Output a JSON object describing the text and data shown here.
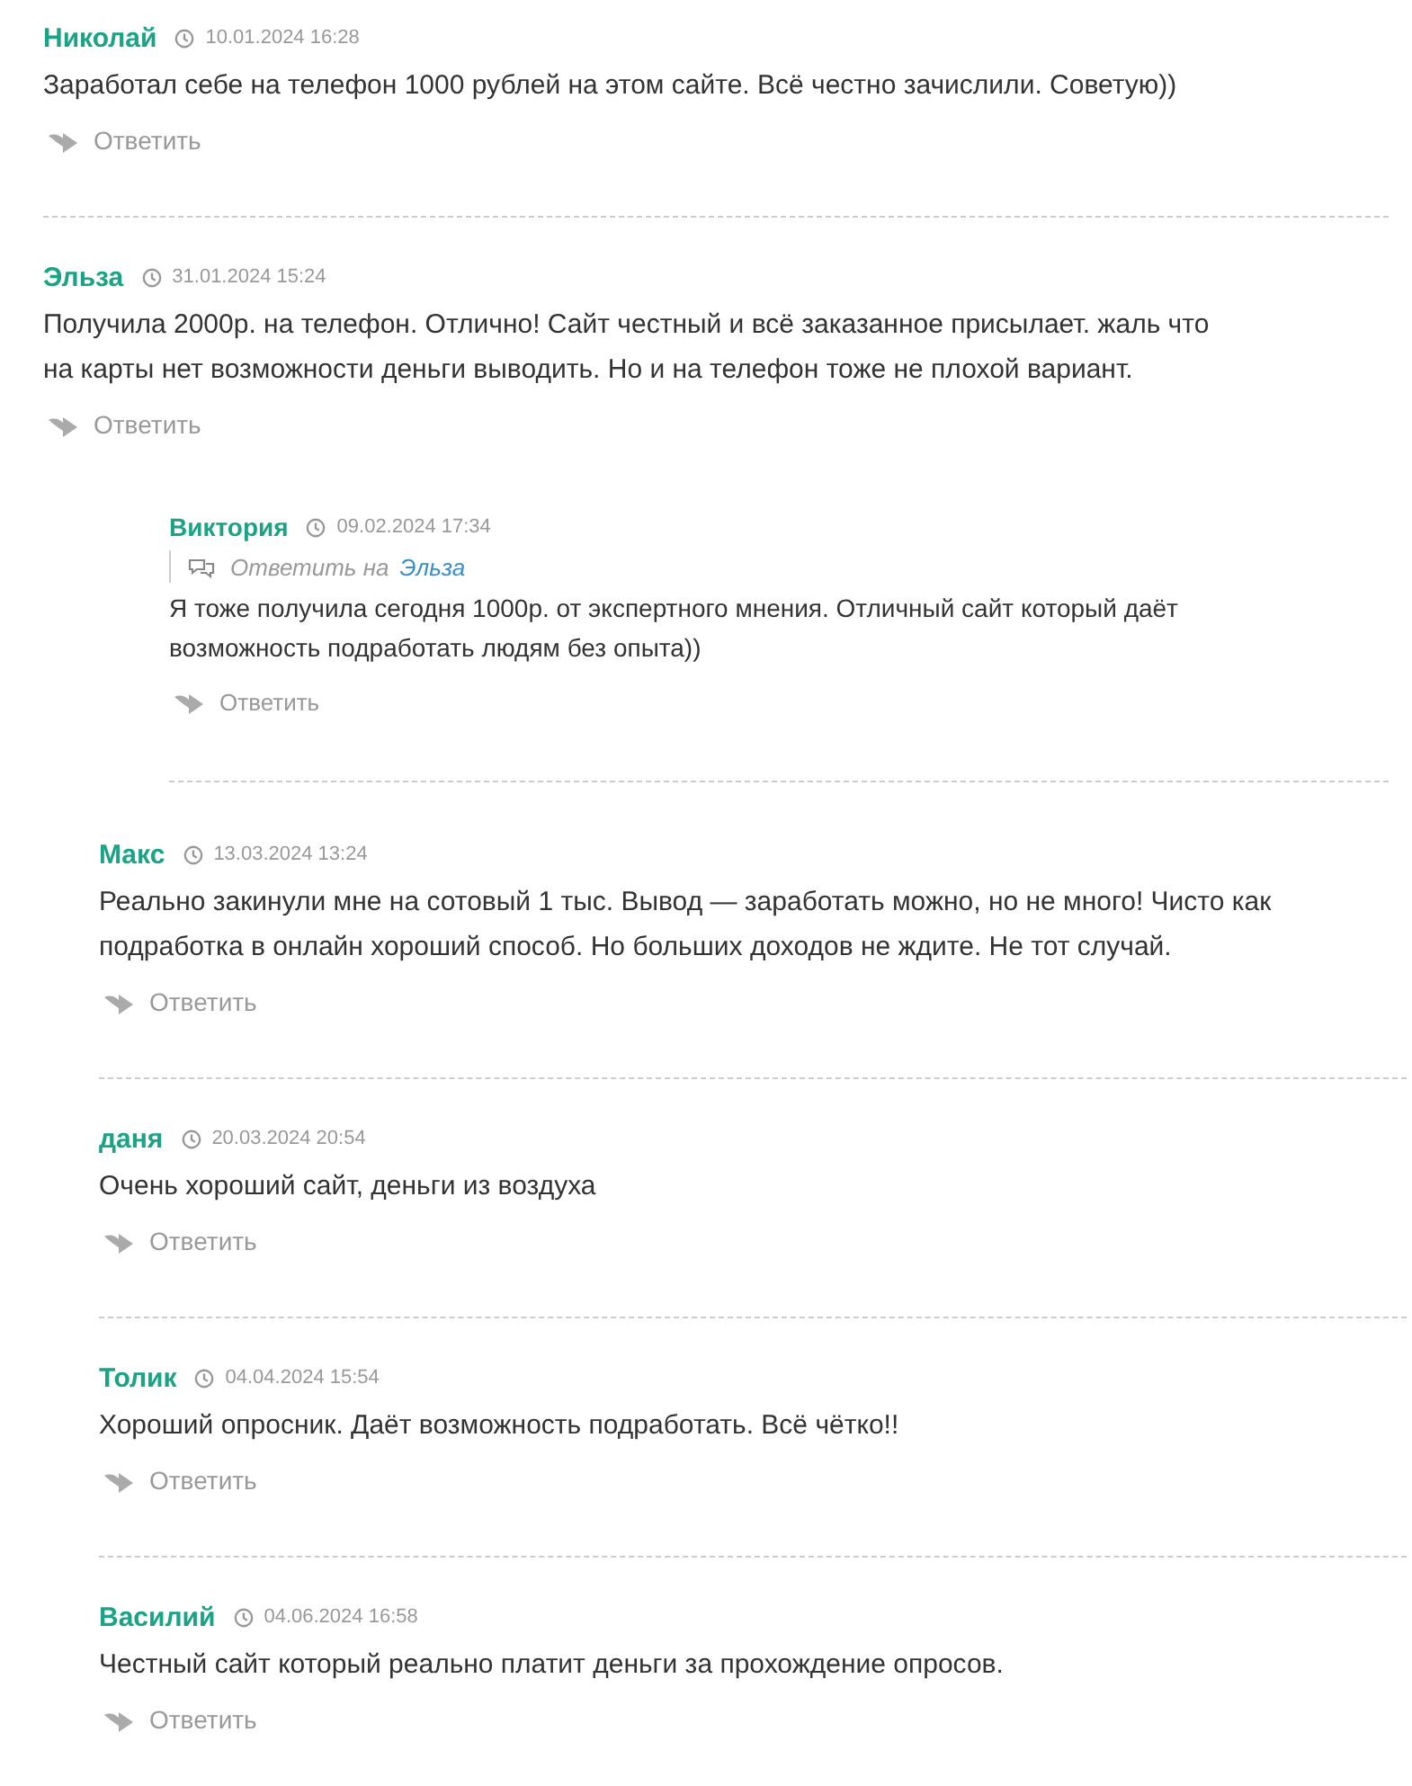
{
  "comments": [
    {
      "author": "Николай",
      "date": "10.01.2024 16:28",
      "text": "Заработал себе на телефон 1000 рублей на этом сайте. Всё честно зачислили. Советую))",
      "reply_label": "Ответить"
    },
    {
      "author": "Эльза",
      "date": "31.01.2024 15:24",
      "text": "Получила 2000р. на телефон. Отлично! Сайт честный и всё заказанное присылает. жаль что\nна карты нет возможности деньги выводить. Но и на телефон тоже не плохой вариант.",
      "reply_label": "Ответить",
      "children": [
        {
          "author": "Виктория",
          "date": "09.02.2024 17:34",
          "reply_to": {
            "label": "Ответить на",
            "name": "Эльза"
          },
          "text": "Я тоже получила сегодня 1000р. от экспертного мнения. Отличный сайт который даёт\nвозможность подработать людям без опыта))",
          "reply_label": "Ответить"
        }
      ]
    }
  ],
  "thread": [
    {
      "author": "Макс",
      "date": "13.03.2024 13:24",
      "text": "Реально закинули мне на сотовый 1 тыс. Вывод — заработать можно, но не много! Чисто как\nподработка в онлайн хороший способ. Но больших доходов не ждите. Не тот случай.",
      "reply_label": "Ответить"
    },
    {
      "author": "даня",
      "date": "20.03.2024 20:54",
      "text": "Очень хороший сайт, деньги из воздуха",
      "reply_label": "Ответить"
    },
    {
      "author": "Толик",
      "date": "04.04.2024 15:54",
      "text": "Хороший опросник. Даёт возможность подработать. Всё чётко!!",
      "reply_label": "Ответить"
    },
    {
      "author": "Василий",
      "date": "04.06.2024 16:58",
      "text": "Честный сайт который реально платит деньги за прохождение опросов.",
      "reply_label": "Ответить"
    }
  ]
}
